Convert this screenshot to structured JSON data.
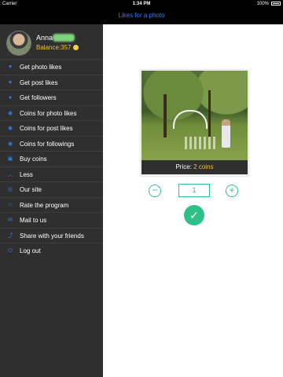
{
  "status_bar": {
    "carrier": "Carrier",
    "time": "1:34 PM",
    "battery": "100%"
  },
  "navbar": {
    "title": "Likes for a photo"
  },
  "sidebar": {
    "user": {
      "name": "Anna",
      "balance_label": "Balance:",
      "balance_value": "357"
    },
    "items": [
      {
        "label": "Get photo likes",
        "icon": "heart-icon"
      },
      {
        "label": "Get post likes",
        "icon": "heart-icon"
      },
      {
        "label": "Get followers",
        "icon": "user-icon"
      },
      {
        "label": "Coins for photo likes",
        "icon": "coin-icon"
      },
      {
        "label": "Coins for post likes",
        "icon": "coin-icon"
      },
      {
        "label": "Coins for followings",
        "icon": "coin-icon"
      },
      {
        "label": "Buy coins",
        "icon": "cart-icon"
      },
      {
        "label": "Less",
        "icon": "chevron-up-icon"
      },
      {
        "label": "Our site",
        "icon": "globe-icon"
      },
      {
        "label": "Rate the program",
        "icon": "star-icon"
      },
      {
        "label": "Mail to us",
        "icon": "mail-icon"
      },
      {
        "label": "Share with your friends",
        "icon": "share-icon"
      },
      {
        "label": "Log out",
        "icon": "logout-icon"
      }
    ]
  },
  "order": {
    "price_label": "Price:",
    "price_value": "2 coins",
    "quantity": "1"
  },
  "colors": {
    "accent": "#2ec089",
    "link": "#2f7df6",
    "sidebar": "#2f2f2f",
    "coins": "#f1c232"
  }
}
